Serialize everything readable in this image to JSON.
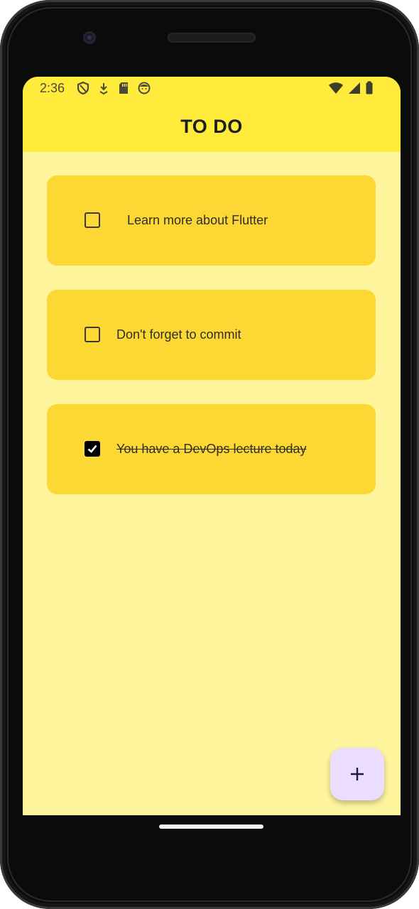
{
  "status_bar": {
    "time": "2:36",
    "left_icons": [
      "shield-icon",
      "download-icon",
      "sd-card-icon",
      "face-icon"
    ],
    "right_icons": [
      "wifi-icon",
      "signal-icon",
      "battery-icon"
    ]
  },
  "app_bar": {
    "title": "TO DO",
    "background": "#FFEB3B"
  },
  "todos": [
    {
      "text": "Learn more about Flutter",
      "checked": false
    },
    {
      "text": "Don't forget to commit",
      "checked": false
    },
    {
      "text": "You have a DevOps lecture today",
      "checked": true
    }
  ],
  "colors": {
    "screen_background": "#FFF59D",
    "card_background": "#FDD835",
    "fab_background": "#EADDFF"
  },
  "fab": {
    "icon": "add-icon"
  }
}
